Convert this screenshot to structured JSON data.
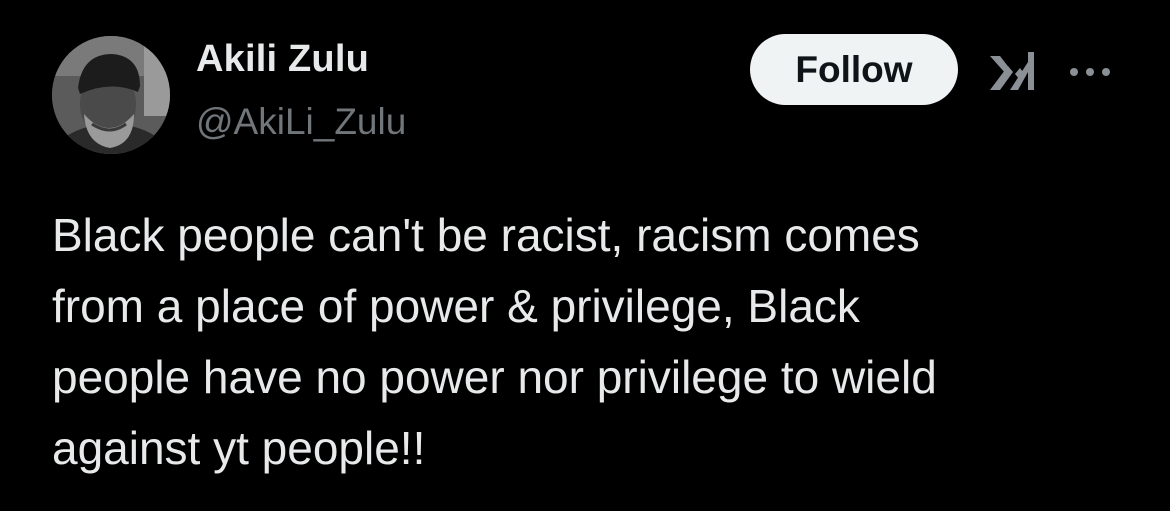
{
  "author": {
    "display_name": "Akili Zulu",
    "handle": "@AkiLi_Zulu",
    "avatar": "avatar"
  },
  "actions": {
    "follow_label": "Follow",
    "grok_icon": "grok-icon",
    "more_icon": "more-options-icon"
  },
  "tweet": {
    "lines": [
      "Black people can't be racist, racism comes",
      "from a place of power & privilege, Black",
      "people have no power nor privilege to wield",
      "against yt people!!"
    ]
  },
  "colors": {
    "background": "#000000",
    "primary_text": "#e7e9ea",
    "secondary_text": "#71767b",
    "follow_bg": "#eff3f4",
    "follow_text": "#0f1419"
  }
}
